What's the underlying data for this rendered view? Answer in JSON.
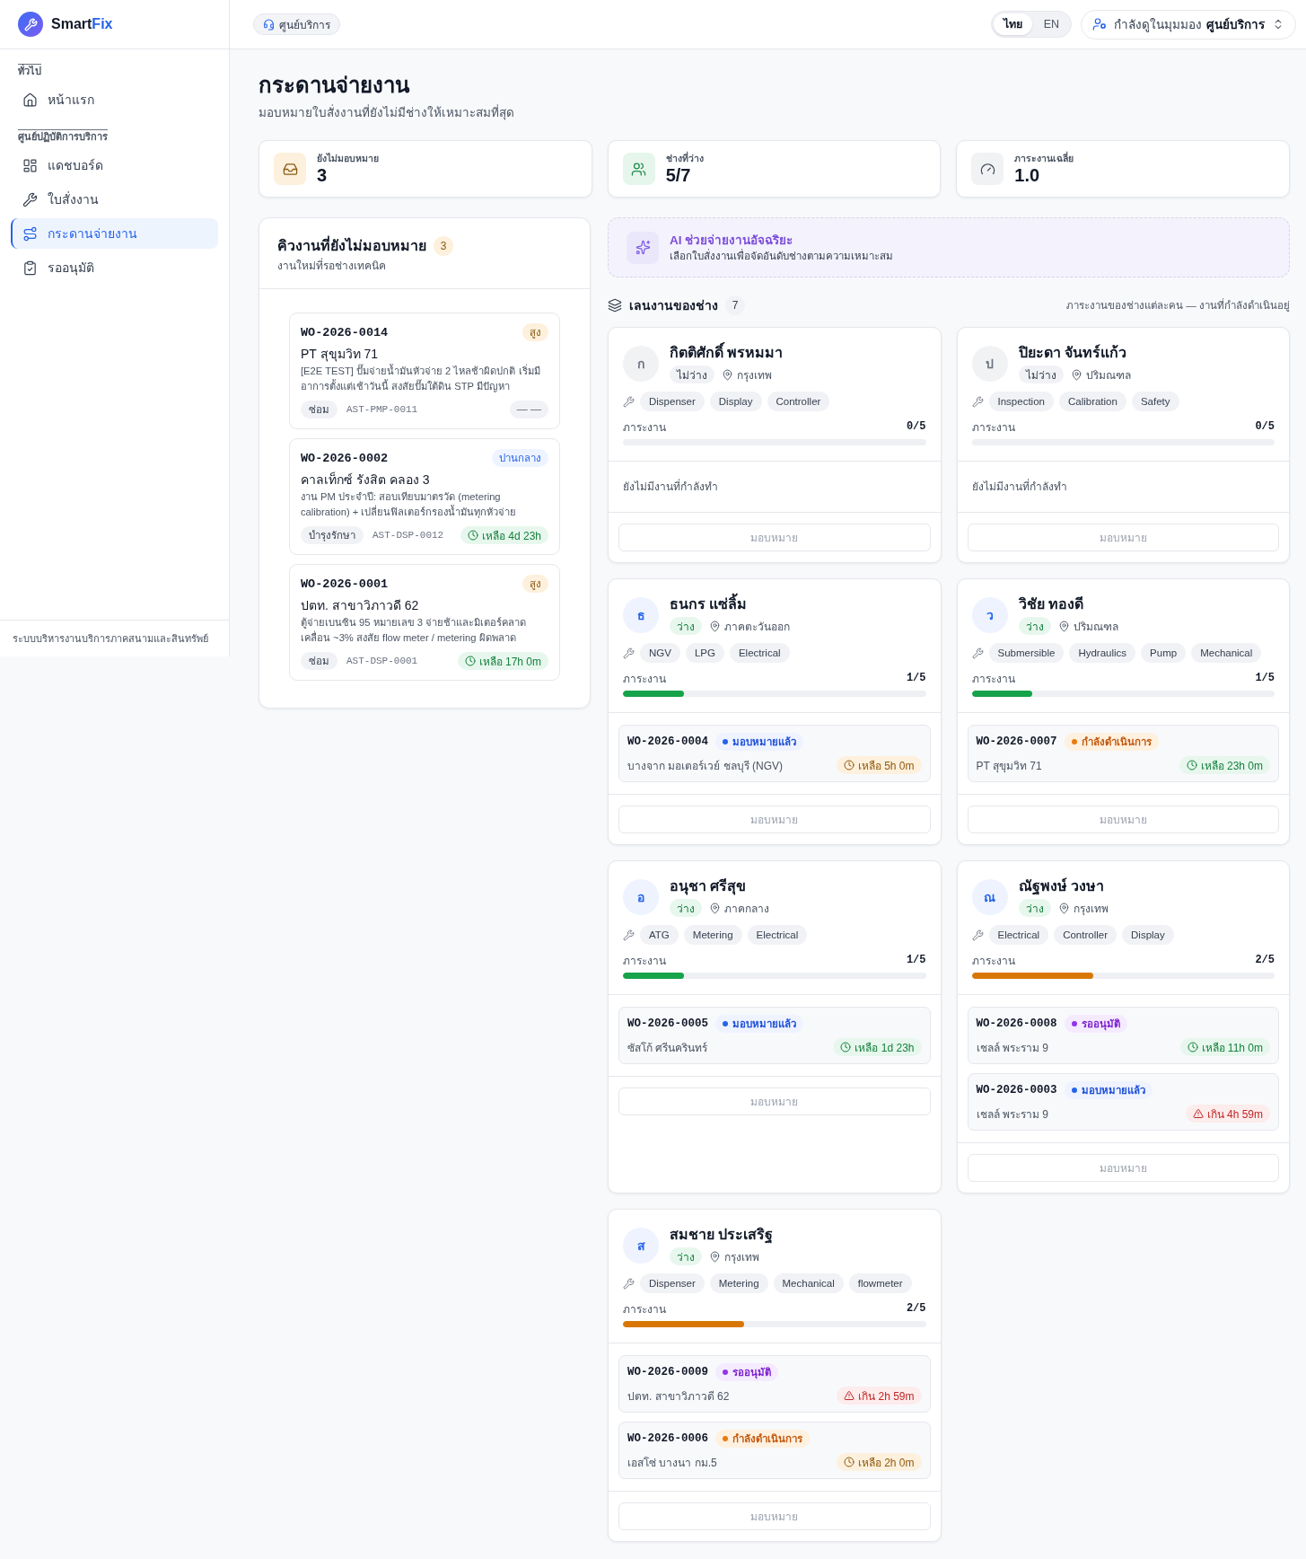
{
  "sidebar": {
    "brand": {
      "name": "Smart",
      "accent": "Fix"
    },
    "sections": [
      {
        "label": "ทั่วไป",
        "items": [
          {
            "kind": "home",
            "label": "หน้าแรก",
            "selected": false
          }
        ]
      },
      {
        "label": "ศูนย์ปฏิบัติการบริการ",
        "items": [
          {
            "kind": "dashboard",
            "label": "แดชบอร์ด",
            "selected": false
          },
          {
            "kind": "work_orders",
            "label": "ใบสั่งงาน",
            "selected": false
          },
          {
            "kind": "dispatch",
            "label": "กระดานจ่ายงาน",
            "selected": true
          },
          {
            "kind": "approvals",
            "label": "รออนุมัติ",
            "selected": false
          }
        ]
      }
    ],
    "footer": "ระบบบริหารงานบริการภาคสนามและสินทรัพย์"
  },
  "header": {
    "context_chip": "ศูนย์บริการ",
    "languages": [
      {
        "label": "ไทย",
        "selected": true
      },
      {
        "label": "EN",
        "selected": false
      }
    ],
    "perspective": {
      "label": "กำลังดูในมุมมอง",
      "value": "ศูนย์บริการ"
    }
  },
  "page": {
    "title": "กระดานจ่ายงาน",
    "subtitle": "มอบหมายใบสั่งงานที่ยังไม่มีช่างให้เหมาะสมที่สุด"
  },
  "stats": [
    {
      "kind": "unassigned",
      "label": "ยังไม่มอบหมาย",
      "value": "3"
    },
    {
      "kind": "available",
      "label": "ช่างที่ว่าง",
      "value": "5/7"
    },
    {
      "kind": "workload",
      "label": "ภาระงานเฉลี่ย",
      "value": "1.0"
    }
  ],
  "queue": {
    "title": "คิวงานที่ยังไม่มอบหมาย",
    "count": "3",
    "subtitle": "งานใหม่ที่รอช่างเทคนิค",
    "orders": [
      {
        "id": "WO-2026-0014",
        "priority": {
          "kind": "high",
          "label": "สูง"
        },
        "site": "PT สุขุมวิท 71",
        "description": "[E2E TEST] ปั๊มจ่ายน้ำมันหัวจ่าย 2 ไหลช้าผิดปกติ เริ่มมีอาการตั้งแต่เช้าวันนี้ สงสัยปั๊มใต้ดิน STP มีปัญหา",
        "type": "ซ่อม",
        "asset": "AST-PMP-0011",
        "sla": {
          "kind": "none",
          "label": "— —"
        }
      },
      {
        "id": "WO-2026-0002",
        "priority": {
          "kind": "medium",
          "label": "ปานกลาง"
        },
        "site": "คาลเท็กซ์ รังสิต คลอง 3",
        "description": "งาน PM ประจำปี: สอบเทียบมาตรวัด (metering calibration) + เปลี่ยนฟิลเตอร์กรองน้ำมันทุกหัวจ่าย",
        "type": "บำรุงรักษา",
        "asset": "AST-DSP-0012",
        "sla": {
          "kind": "ok",
          "label": "เหลือ 4d 23h"
        }
      },
      {
        "id": "WO-2026-0001",
        "priority": {
          "kind": "high",
          "label": "สูง"
        },
        "site": "ปตท. สาขาวิภาวดี 62",
        "description": "ตู้จ่ายเบนซิน 95 หมายเลข 3 จ่ายช้าและมิเตอร์คลาดเคลื่อน ~3% สงสัย flow meter / metering ผิดพลาด",
        "type": "ซ่อม",
        "asset": "AST-DSP-0001",
        "sla": {
          "kind": "ok",
          "label": "เหลือ 17h 0m"
        }
      }
    ]
  },
  "ai_assist": {
    "title": "AI ช่วยจ่ายงานอัจฉริยะ",
    "subtitle": "เลือกใบสั่งงานเพื่อจัดอันดับช่างตามความเหมาะสม"
  },
  "lanes": {
    "title": "เลนงานของช่าง",
    "count": "7",
    "note": "ภาระงานของช่างแต่ละคน — งานที่กำลังดำเนินอยู่",
    "technicians": [
      {
        "initial": "ก",
        "name": "กิตติศักดิ์ พรหมมา",
        "available": false,
        "status": "ไม่ว่าง",
        "region": "กรุงเทพ",
        "skills": [
          "Dispenser",
          "Display",
          "Controller"
        ],
        "workload_label": "ภาระงาน",
        "workload": "0/5",
        "level": 0,
        "empty_text": "ยังไม่มีงานที่กำลังทำ",
        "assign": {
          "label": "มอบหมาย",
          "disabled": true
        }
      },
      {
        "initial": "ป",
        "name": "ปิยะดา จันทร์แก้ว",
        "available": false,
        "status": "ไม่ว่าง",
        "region": "ปริมณฑล",
        "skills": [
          "Inspection",
          "Calibration",
          "Safety"
        ],
        "workload_label": "ภาระงาน",
        "workload": "0/5",
        "level": 0,
        "empty_text": "ยังไม่มีงานที่กำลังทำ",
        "assign": {
          "label": "มอบหมาย",
          "disabled": true
        }
      },
      {
        "initial": "ธ",
        "name": "ธนกร แซ่ลิ้ม",
        "available": true,
        "status": "ว่าง",
        "region": "ภาคตะวันออก",
        "skills": [
          "NGV",
          "LPG",
          "Electrical"
        ],
        "workload_label": "ภาระงาน",
        "workload": "1/5",
        "level": 0.2,
        "jobs": [
          {
            "id": "WO-2026-0004",
            "status": {
              "kind": "assigned",
              "label": "มอบหมายแล้ว"
            },
            "site": "บางจาก มอเตอร์เวย์ ชลบุรี (NGV)",
            "sla": {
              "kind": "soon",
              "label": "เหลือ 5h 0m"
            }
          }
        ],
        "assign": {
          "label": "มอบหมาย",
          "disabled": true
        }
      },
      {
        "initial": "ว",
        "name": "วิชัย ทองดี",
        "available": true,
        "status": "ว่าง",
        "region": "ปริมณฑล",
        "skills": [
          "Submersible",
          "Hydraulics",
          "Pump",
          "Mechanical"
        ],
        "workload_label": "ภาระงาน",
        "workload": "1/5",
        "level": 0.2,
        "jobs": [
          {
            "id": "WO-2026-0007",
            "status": {
              "kind": "in_progress",
              "label": "กำลังดำเนินการ"
            },
            "site": "PT สุขุมวิท 71",
            "sla": {
              "kind": "ok",
              "label": "เหลือ 23h 0m"
            }
          }
        ],
        "assign": {
          "label": "มอบหมาย",
          "disabled": true
        }
      },
      {
        "initial": "อ",
        "name": "อนุชา ศรีสุข",
        "available": true,
        "status": "ว่าง",
        "region": "ภาคกลาง",
        "skills": [
          "ATG",
          "Metering",
          "Electrical"
        ],
        "workload_label": "ภาระงาน",
        "workload": "1/5",
        "level": 0.2,
        "jobs": [
          {
            "id": "WO-2026-0005",
            "status": {
              "kind": "assigned",
              "label": "มอบหมายแล้ว"
            },
            "site": "ซัสโก้ ศรีนครินทร์",
            "sla": {
              "kind": "ok",
              "label": "เหลือ 1d 23h"
            }
          }
        ],
        "assign": {
          "label": "มอบหมาย",
          "disabled": true
        }
      },
      {
        "initial": "ณ",
        "name": "ณัฐพงษ์ วงษา",
        "available": true,
        "status": "ว่าง",
        "region": "กรุงเทพ",
        "skills": [
          "Electrical",
          "Controller",
          "Display"
        ],
        "workload_label": "ภาระงาน",
        "workload": "2/5",
        "level": 0.4,
        "jobs": [
          {
            "id": "WO-2026-0008",
            "status": {
              "kind": "pending_approval",
              "label": "รออนุมัติ"
            },
            "site": "เชลล์ พระราม 9",
            "sla": {
              "kind": "ok",
              "label": "เหลือ 11h 0m"
            }
          },
          {
            "id": "WO-2026-0003",
            "status": {
              "kind": "assigned",
              "label": "มอบหมายแล้ว"
            },
            "site": "เชลล์ พระราม 9",
            "sla": {
              "kind": "overdue",
              "label": "เกิน 4h 59m"
            }
          }
        ],
        "assign": {
          "label": "มอบหมาย",
          "disabled": true
        }
      },
      {
        "initial": "ส",
        "name": "สมชาย ประเสริฐ",
        "available": true,
        "status": "ว่าง",
        "region": "กรุงเทพ",
        "skills": [
          "Dispenser",
          "Metering",
          "Mechanical",
          "flowmeter"
        ],
        "workload_label": "ภาระงาน",
        "workload": "2/5",
        "level": 0.4,
        "jobs": [
          {
            "id": "WO-2026-0009",
            "status": {
              "kind": "pending_approval",
              "label": "รออนุมัติ"
            },
            "site": "ปตท. สาขาวิภาวดี 62",
            "sla": {
              "kind": "overdue",
              "label": "เกิน 2h 59m"
            }
          },
          {
            "id": "WO-2026-0006",
            "status": {
              "kind": "in_progress",
              "label": "กำลังดำเนินการ"
            },
            "site": "เอสโซ่ บางนา กม.5",
            "sla": {
              "kind": "soon",
              "label": "เหลือ 2h 0m"
            }
          }
        ],
        "assign": {
          "label": "มอบหมาย",
          "disabled": true
        }
      }
    ]
  }
}
